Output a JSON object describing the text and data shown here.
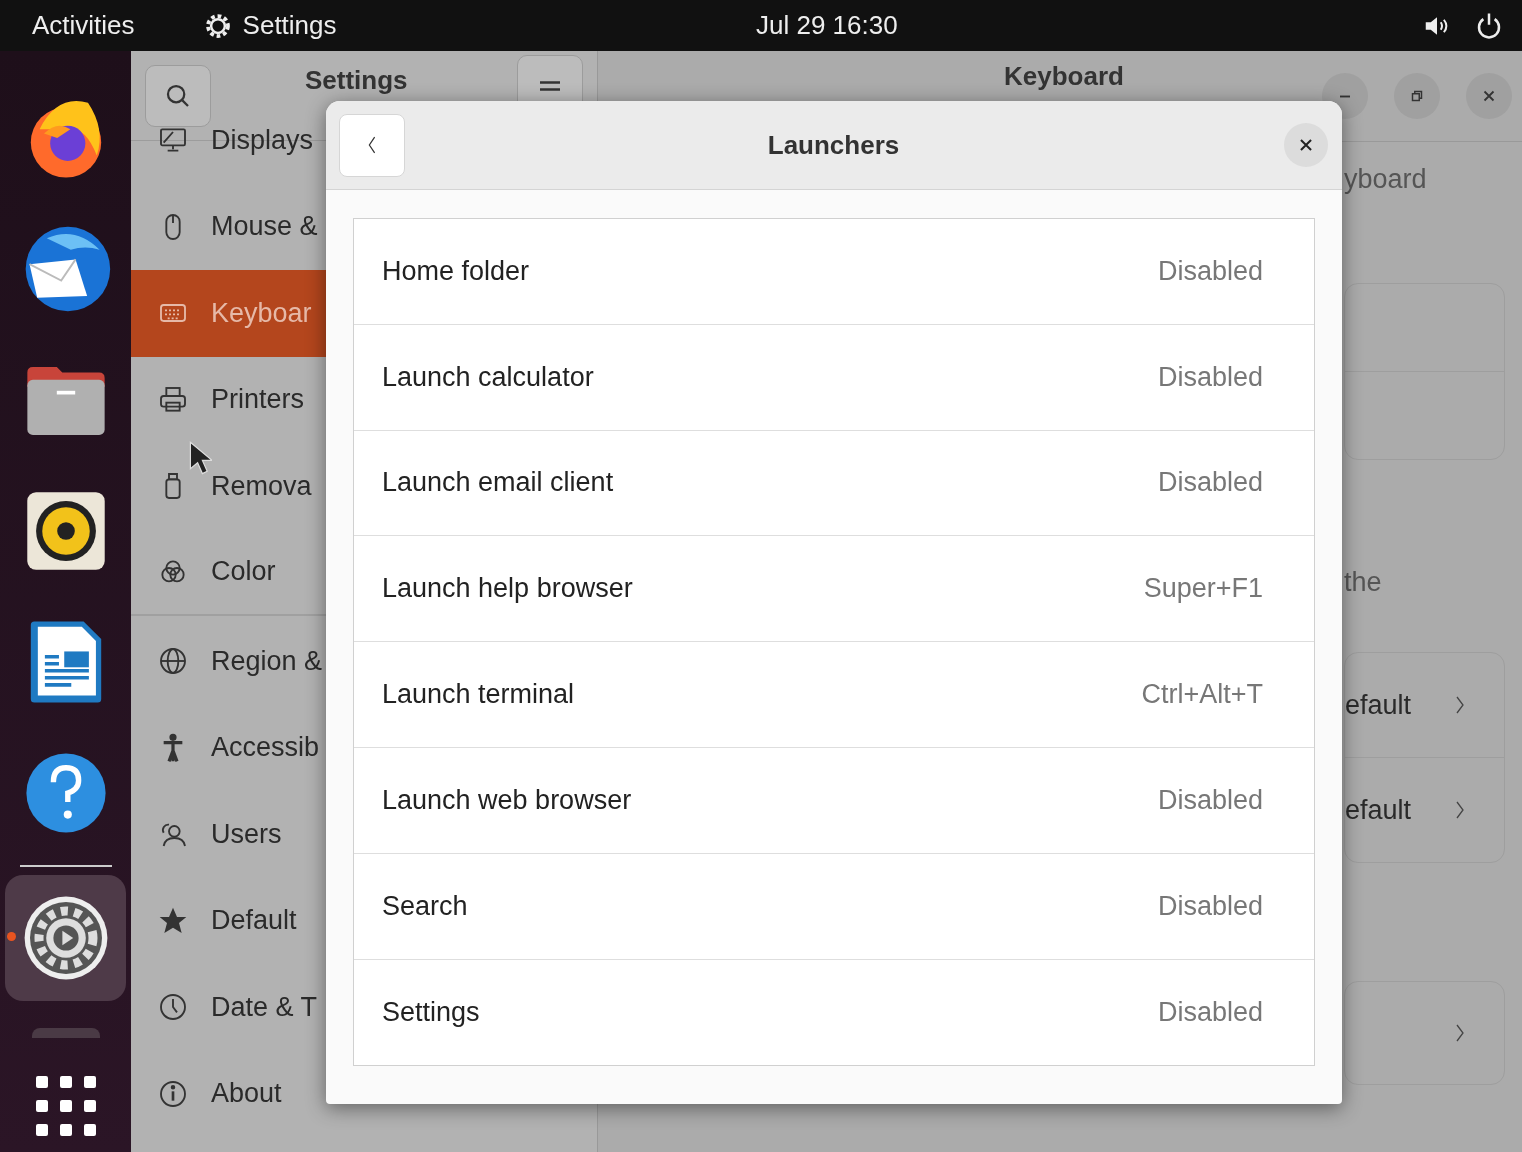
{
  "top_bar": {
    "activities": "Activities",
    "app_name": "Settings",
    "clock": "Jul 29  16:30"
  },
  "dock": {
    "items": [
      {
        "kind": "browser",
        "selected": false
      },
      {
        "kind": "mail",
        "selected": false
      },
      {
        "kind": "files",
        "selected": false
      },
      {
        "kind": "music",
        "selected": false
      },
      {
        "kind": "writer",
        "selected": false
      },
      {
        "kind": "help",
        "selected": false
      },
      {
        "kind": "settings",
        "selected": true
      }
    ]
  },
  "settings_window": {
    "sidebar_title": "Settings",
    "title": "Keyboard",
    "sidebar_items": [
      {
        "kind": "display",
        "label": "Displays",
        "selected": false
      },
      {
        "kind": "mouse",
        "label": "Mouse &",
        "selected": false
      },
      {
        "kind": "keyboard",
        "label": "Keyboar",
        "selected": true
      },
      {
        "kind": "printer",
        "label": "Printers",
        "selected": false
      },
      {
        "kind": "usb",
        "label": "Remova",
        "selected": false
      },
      {
        "kind": "color",
        "label": "Color",
        "selected": false,
        "divider": true
      },
      {
        "kind": "globe",
        "label": "Region &",
        "selected": false
      },
      {
        "kind": "person",
        "label": "Accessib",
        "selected": false
      },
      {
        "kind": "users",
        "label": "Users",
        "selected": false
      },
      {
        "kind": "star",
        "label": "Default",
        "selected": false
      },
      {
        "kind": "clock",
        "label": "Date & T",
        "selected": false
      },
      {
        "kind": "info",
        "label": "About",
        "selected": false
      }
    ],
    "content": {
      "heading": "yboard",
      "note": "the",
      "rows": [
        "efault",
        "efault"
      ]
    }
  },
  "dialog": {
    "title": "Launchers",
    "shortcuts": [
      {
        "label": "Home folder",
        "value": "Disabled"
      },
      {
        "label": "Launch calculator",
        "value": "Disabled"
      },
      {
        "label": "Launch email client",
        "value": "Disabled"
      },
      {
        "label": "Launch help browser",
        "value": "Super+F1"
      },
      {
        "label": "Launch terminal",
        "value": "Ctrl+Alt+T"
      },
      {
        "label": "Launch web browser",
        "value": "Disabled"
      },
      {
        "label": "Search",
        "value": "Disabled"
      },
      {
        "label": "Settings",
        "value": "Disabled"
      }
    ]
  }
}
